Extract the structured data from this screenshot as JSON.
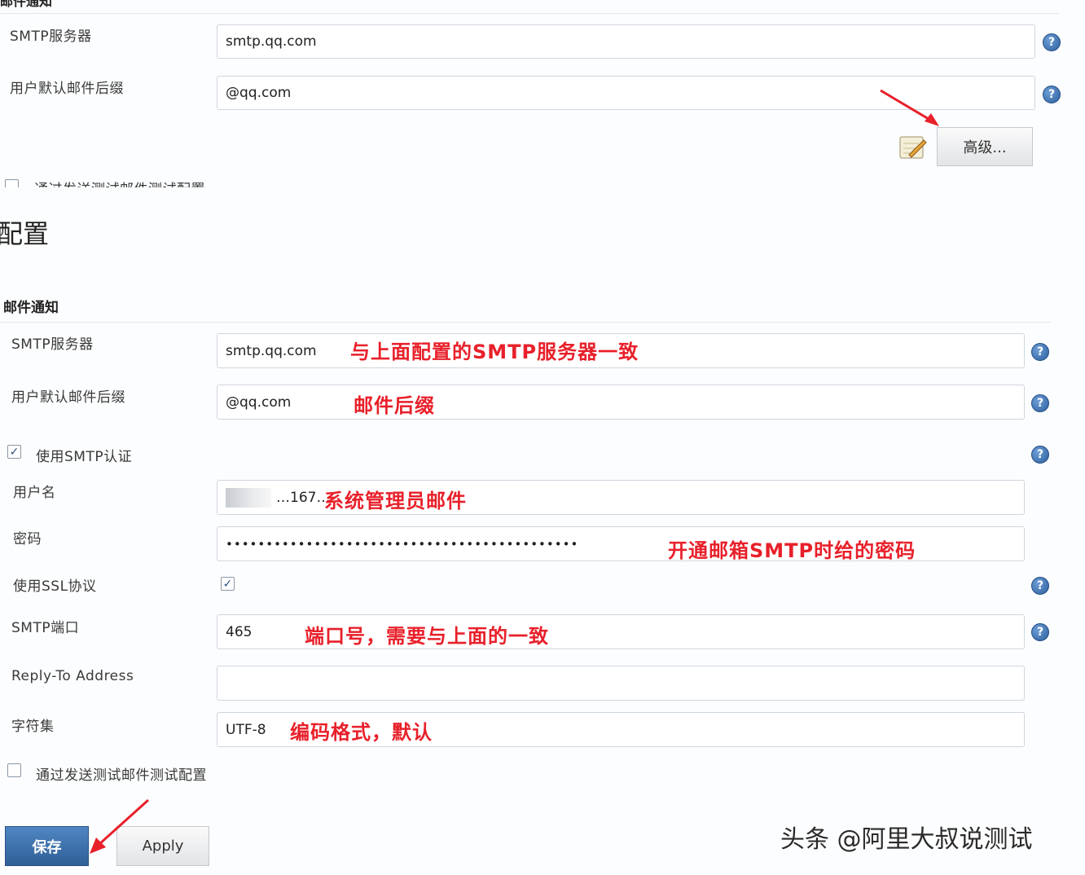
{
  "top_section": {
    "header_text": "邮件通知",
    "smtp_server_label": "SMTP服务器",
    "smtp_server_value": "smtp.qq.com",
    "suffix_label": "用户默认邮件后缀",
    "suffix_value": "@qq.com",
    "advanced_button": "高级...",
    "test_config_label": "通过发送测试邮件测试配置"
  },
  "config_title": "配置",
  "mail_section": {
    "header": "邮件通知",
    "smtp_server_label": "SMTP服务器",
    "smtp_server_value": "smtp.qq.com",
    "smtp_server_note": "与上面配置的SMTP服务器一致",
    "suffix_label": "用户默认邮件后缀",
    "suffix_value": "@qq.com",
    "suffix_note": "邮件后缀",
    "use_smtp_auth_label": "使用SMTP认证",
    "use_smtp_auth_checked": true,
    "username_label": "用户名",
    "username_value": "…167…",
    "username_note": "系统管理员邮件",
    "password_label": "密码",
    "password_value": "••••••••••••••••••••••••••••••••••••••••••••",
    "password_note": "开通邮箱SMTP时给的密码",
    "use_ssl_label": "使用SSL协议",
    "use_ssl_checked": true,
    "smtp_port_label": "SMTP端口",
    "smtp_port_value": "465",
    "smtp_port_note": "端口号，需要与上面的一致",
    "reply_to_label": "Reply-To Address",
    "reply_to_value": "",
    "charset_label": "字符集",
    "charset_value": "UTF-8",
    "charset_note": "编码格式，默认",
    "test_config_label": "通过发送测试邮件测试配置",
    "test_config_checked": false
  },
  "buttons": {
    "save": "保存",
    "apply": "Apply"
  },
  "help_icon_glyph": "?",
  "check_glyph": "✓",
  "watermark": "头条 @阿里大叔说测试",
  "colors": {
    "annotation": "#e8202a",
    "save_button": "#3a6ea5",
    "help_icon": "#2d5f9e"
  }
}
